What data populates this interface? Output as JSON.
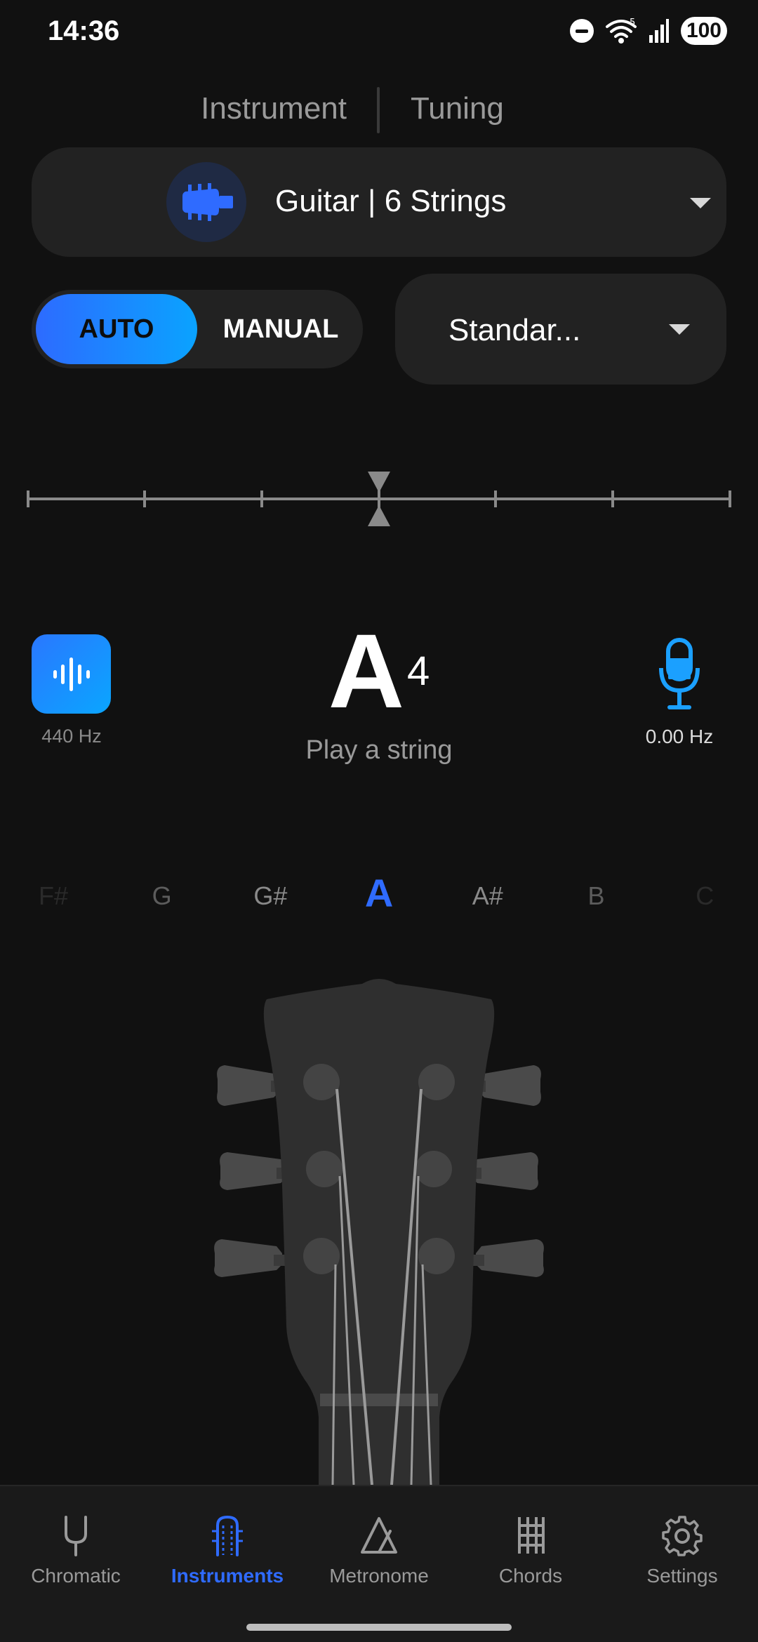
{
  "status_bar": {
    "time": "14:36",
    "battery": "100",
    "network_badge": "5"
  },
  "header": {
    "tabs": [
      {
        "label": "Instrument",
        "active": true
      },
      {
        "label": "Tuning",
        "active": false
      }
    ]
  },
  "instrument": {
    "label": "Guitar | 6 Strings",
    "icon": "guitar-headstock-icon"
  },
  "mode": {
    "options": [
      "AUTO",
      "MANUAL"
    ],
    "selected": "AUTO"
  },
  "tuning": {
    "label": "Standar..."
  },
  "meter": {
    "offset_cents": 0
  },
  "readout": {
    "reference_hz": "440 Hz",
    "note": "A",
    "octave": "4",
    "prompt": "Play a string",
    "input_hz": "0.00 Hz"
  },
  "note_strip": {
    "notes": [
      "F#",
      "G",
      "G#",
      "A",
      "A#",
      "B",
      "C"
    ],
    "active_index": 3
  },
  "nav": {
    "items": [
      {
        "label": "Chromatic",
        "icon": "tuning-fork-icon",
        "active": false
      },
      {
        "label": "Instruments",
        "icon": "instruments-icon",
        "active": true
      },
      {
        "label": "Metronome",
        "icon": "metronome-icon",
        "active": false
      },
      {
        "label": "Chords",
        "icon": "chords-icon",
        "active": false
      },
      {
        "label": "Settings",
        "icon": "settings-gear-icon",
        "active": false
      }
    ]
  },
  "colors": {
    "accent": "#2f6bff",
    "accent_cyan": "#0aa3ff",
    "background": "#111111",
    "surface": "#222222"
  }
}
